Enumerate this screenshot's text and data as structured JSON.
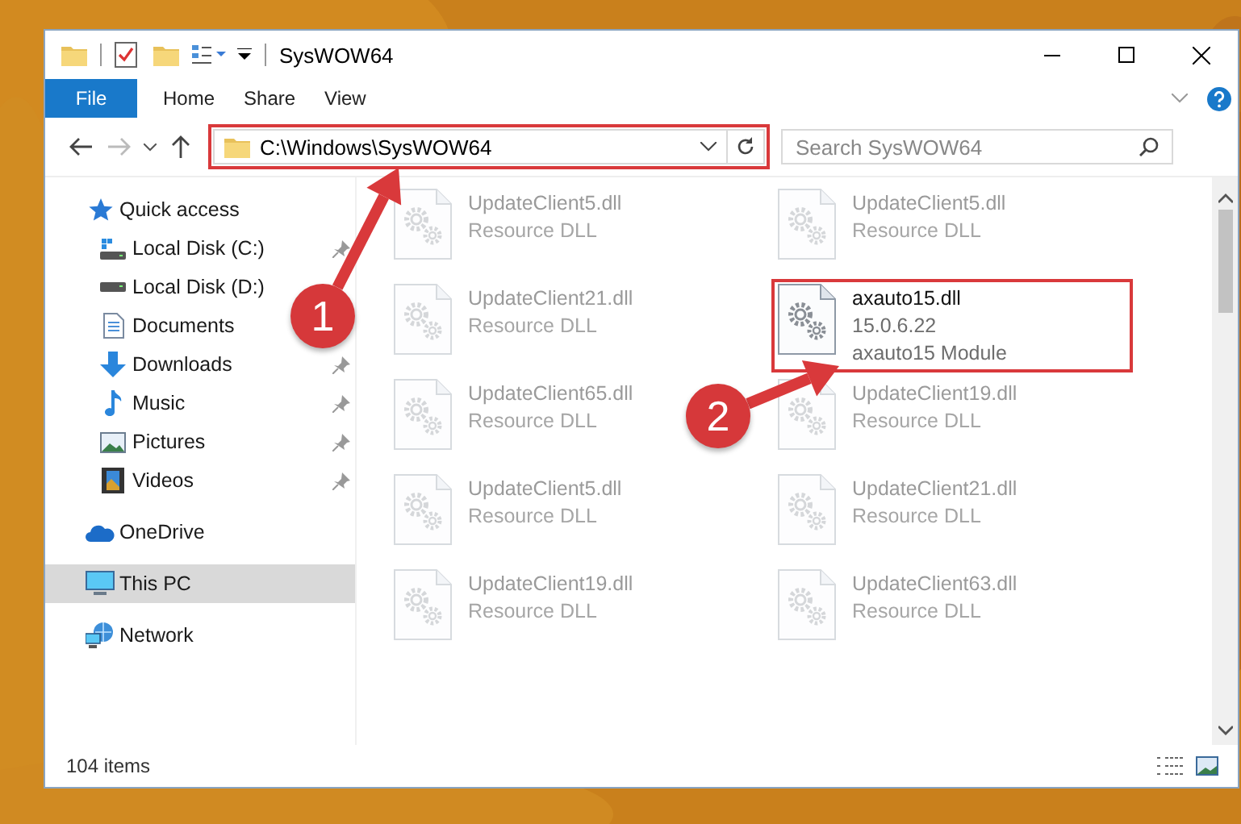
{
  "window": {
    "title": "SysWOW64"
  },
  "ribbon": {
    "tabs": [
      {
        "label": "File",
        "kind": "file"
      },
      {
        "label": "Home",
        "kind": "tab"
      },
      {
        "label": "Share",
        "kind": "tab"
      },
      {
        "label": "View",
        "kind": "tab"
      }
    ]
  },
  "address_bar": {
    "path": "C:\\Windows\\SysWOW64",
    "highlighted": true
  },
  "search": {
    "placeholder": "Search SysWOW64"
  },
  "navigation_pane": {
    "items": [
      {
        "label": "Quick access",
        "kind": "star",
        "selected": false,
        "children": [
          {
            "label": "Local Disk (C:)",
            "kind": "system-drive",
            "selected": false,
            "pinned": true
          },
          {
            "label": "Local Disk (D:)",
            "kind": "drive",
            "selected": false
          },
          {
            "label": "Documents",
            "kind": "document",
            "selected": false
          },
          {
            "label": "Downloads",
            "kind": "download",
            "selected": false,
            "pinned": true
          },
          {
            "label": "Music",
            "kind": "music",
            "selected": false,
            "pinned": true
          },
          {
            "label": "Pictures",
            "kind": "pictures",
            "selected": false,
            "pinned": true
          },
          {
            "label": "Videos",
            "kind": "video",
            "selected": false,
            "pinned": true
          }
        ]
      },
      {
        "label": "OneDrive",
        "kind": "cloud",
        "selected": false
      },
      {
        "label": "This PC",
        "kind": "computer",
        "selected": true
      },
      {
        "label": "Network",
        "kind": "network",
        "selected": false
      }
    ]
  },
  "files": [
    {
      "name": "UpdateClient5.dll",
      "type": "Resource DLL",
      "highlighted": false
    },
    {
      "name": "UpdateClient5.dll",
      "type": "Resource DLL",
      "highlighted": false
    },
    {
      "name": "UpdateClient21.dll",
      "type": "Resource DLL",
      "highlighted": false
    },
    {
      "name": "axauto15.dll",
      "version": "15.0.6.22",
      "type": "axauto15 Module",
      "highlighted": true
    },
    {
      "name": "UpdateClient65.dll",
      "type": "Resource DLL",
      "highlighted": false
    },
    {
      "name": "UpdateClient19.dll",
      "type": "Resource DLL",
      "highlighted": false
    },
    {
      "name": "UpdateClient5.dll",
      "type": "Resource DLL",
      "highlighted": false
    },
    {
      "name": "UpdateClient21.dll",
      "type": "Resource DLL",
      "highlighted": false
    },
    {
      "name": "UpdateClient19.dll",
      "type": "Resource DLL",
      "highlighted": false
    },
    {
      "name": "UpdateClient63.dll",
      "type": "Resource DLL",
      "highlighted": false
    }
  ],
  "status_bar": {
    "item_count": "104 items"
  },
  "annotations": [
    {
      "label": "1"
    },
    {
      "label": "2"
    }
  ]
}
